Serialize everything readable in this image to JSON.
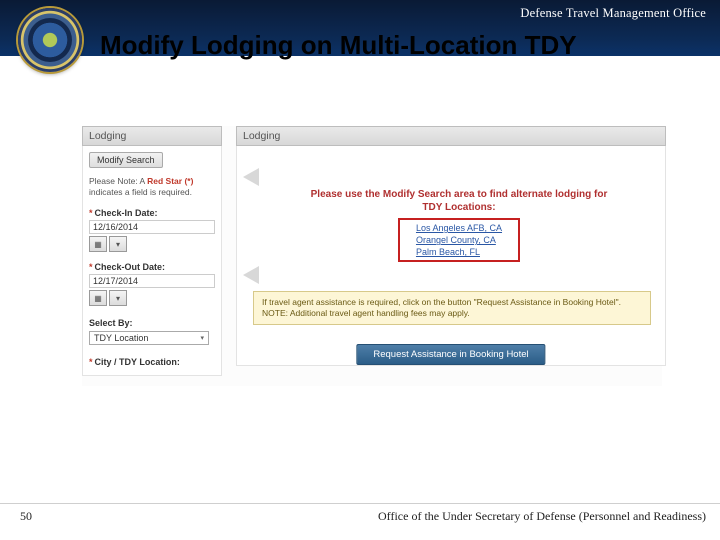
{
  "header": {
    "org": "Defense Travel Management Office"
  },
  "title": "Modify Lodging on Multi-Location TDY",
  "left": {
    "panel_title": "Lodging",
    "modify_search": "Modify Search",
    "note_prefix": "Please Note: A ",
    "note_red": "Red Star (*)",
    "note_suffix": " indicates a field is required.",
    "checkin_label": "Check-In Date:",
    "checkin_value": "12/16/2014",
    "checkout_label": "Check-Out Date:",
    "checkout_value": "12/17/2014",
    "select_by_label": "Select By:",
    "select_by_value": "TDY Location",
    "city_label": "City / TDY Location:"
  },
  "right": {
    "panel_title": "Lodging",
    "notice_line1": "Please use the Modify Search area to find alternate lodging for",
    "notice_line2": "TDY Locations:",
    "locations": {
      "a": "Los Angeles AFB, CA",
      "b": "Orangel County, CA",
      "c": "Palm Beach, FL"
    },
    "agent_note": "If travel agent assistance is required, click on the button \"Request Assistance in Booking Hotel\". NOTE: Additional travel agent handling fees may apply.",
    "assist_button": "Request Assistance in Booking Hotel"
  },
  "footer": {
    "page": "50",
    "text": "Office of the Under Secretary of Defense (Personnel and Readiness)"
  }
}
